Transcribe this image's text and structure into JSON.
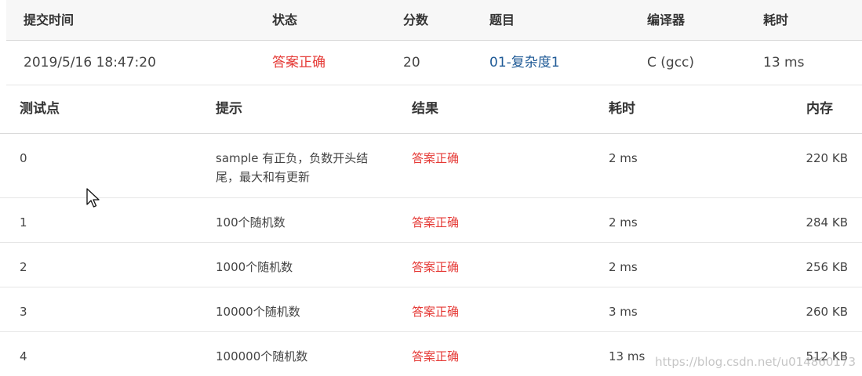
{
  "summary": {
    "headers": {
      "time": "提交时间",
      "status": "状态",
      "score": "分数",
      "problem": "题目",
      "compiler": "编译器",
      "duration": "耗时"
    },
    "row": {
      "time": "2019/5/16 18:47:20",
      "status": "答案正确",
      "score": "20",
      "problem": "01-复杂度1",
      "compiler": "C (gcc)",
      "duration": "13 ms"
    }
  },
  "details": {
    "headers": {
      "case": "测试点",
      "hint": "提示",
      "result": "结果",
      "time": "耗时",
      "memory": "内存"
    },
    "rows": [
      {
        "case": "0",
        "hint": "sample 有正负，负数开头结尾，最大和有更新",
        "result": "答案正确",
        "time": "2 ms",
        "memory": "220 KB"
      },
      {
        "case": "1",
        "hint": "100个随机数",
        "result": "答案正确",
        "time": "2 ms",
        "memory": "284 KB"
      },
      {
        "case": "2",
        "hint": "1000个随机数",
        "result": "答案正确",
        "time": "2 ms",
        "memory": "256 KB"
      },
      {
        "case": "3",
        "hint": "10000个随机数",
        "result": "答案正确",
        "time": "3 ms",
        "memory": "260 KB"
      },
      {
        "case": "4",
        "hint": "100000个随机数",
        "result": "答案正确",
        "time": "13 ms",
        "memory": "512 KB"
      }
    ]
  },
  "colors": {
    "accepted": "#e53935",
    "link": "#1f5a96",
    "header_bg": "#f7f7f7"
  },
  "watermark": "https://blog.csdn.net/u014860173",
  "cursor_icon": "mouse-pointer-icon"
}
